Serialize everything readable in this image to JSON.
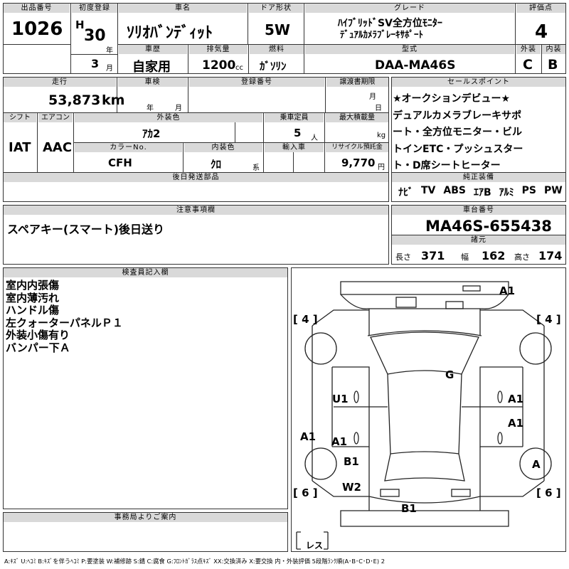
{
  "header": {
    "lot_no_label": "出品番号",
    "lot_no": "1026",
    "first_reg_label": "初度登録",
    "era": "H",
    "year": "30",
    "year_unit": "年",
    "month": "3",
    "month_unit": "月",
    "car_name_label": "車名",
    "car_name": "ｿﾘｵﾊﾞﾝﾃﾞｨｯﾄ",
    "door_label": "ドア形状",
    "door": "5W",
    "grade_label": "グレード",
    "grade_line1": "ﾊｲﾌﾞﾘｯﾄﾞSV全方位ﾓﾆﾀｰ",
    "grade_line2": "ﾃﾞｭｱﾙｶﾒﾗﾌﾞﾚｰｷｻﾎﾟｰﾄ",
    "score_label": "評価点",
    "score": "4",
    "history_label": "車歴",
    "history": "自家用",
    "displacement_label": "排気量",
    "displacement": "1200",
    "displacement_unit": "cc",
    "fuel_label": "燃料",
    "fuel": "ｶﾞｿﾘﾝ",
    "model_label": "型式",
    "model": "DAA-MA46S",
    "ext_label": "外装",
    "ext_grade": "C",
    "int_label": "内装",
    "int_grade": "B"
  },
  "row2": {
    "mileage_label": "走行",
    "mileage": "53,873",
    "mileage_unit": "km",
    "inspection_label": "車検",
    "inspection_year": "年",
    "inspection_month": "月",
    "reg_no_label": "登録番号",
    "transfer_label": "譲渡書期限",
    "transfer_month": "月",
    "transfer_day": "日",
    "shift_label": "シフト",
    "shift": "IAT",
    "ac_label": "エアコン",
    "ac": "AAC",
    "color_label": "外装色",
    "color": "ｱｶ2",
    "capacity_label": "乗車定員",
    "capacity": "5",
    "capacity_unit": "人",
    "load_label": "最大積載量",
    "load_unit": "kg",
    "color_no_label": "カラーNo.",
    "color_no": "CFH",
    "int_color_label": "内装色",
    "int_color": "ｸﾛ",
    "int_color_unit": "系",
    "import_label": "輸入車",
    "recycle_label": "リサイクル預託金",
    "recycle": "9,770",
    "recycle_unit": "円",
    "later_label": "後日発送部品"
  },
  "sales": {
    "label": "セールスポイント",
    "lines": [
      "★オークションデビュー★",
      "デュアルカメラブレーキサポ",
      "ート・全方位モニター・ビル",
      "トインETC・プッシュスター",
      "ト・D席シートヒーター"
    ]
  },
  "equipment": {
    "label": "純正装備",
    "items": [
      "ﾅﾋﾞ",
      "TV",
      "ABS",
      "ｴｱB",
      "ｱﾙﾐ",
      "PS",
      "PW"
    ]
  },
  "notes": {
    "label": "注意事項欄",
    "text": "スペアキー(スマート)後日送り"
  },
  "chassis": {
    "label": "車台番号",
    "number": "MA46S-655438",
    "spec_label": "諸元",
    "length_label": "長さ",
    "length": "371",
    "width_label": "幅",
    "width": "162",
    "height_label": "高さ",
    "height": "174"
  },
  "inspector": {
    "label": "検査員記入欄",
    "lines": [
      "室内内張傷",
      "室内薄汚れ",
      "ハンドル傷",
      "左クォーターパネルＰ１",
      "外装小傷有り",
      "バンパー下Ａ"
    ]
  },
  "office": {
    "label": "事務局よりご案内"
  },
  "diagram": {
    "marks": [
      "A1",
      "G",
      "U1",
      "A1",
      "A1",
      "A1",
      "A1",
      "B1",
      "W2",
      "B1",
      "A"
    ],
    "tires": [
      "4",
      "4",
      "6",
      "6"
    ],
    "res_label": "レス"
  },
  "legend": "A:ｷｽﾞ U:ﾍｺﾐ B:ｷｽﾞを伴うﾍｺﾐ P:要塗装 W:補修跡 S:錆 C:腐食 G:ﾌﾛﾝﾄｶﾞﾗｽ点ｷｽﾞ XX:交換済み X:要交換 内・外装評価 5段階ﾗﾝｸ順(A･B･C･D･E) 2"
}
